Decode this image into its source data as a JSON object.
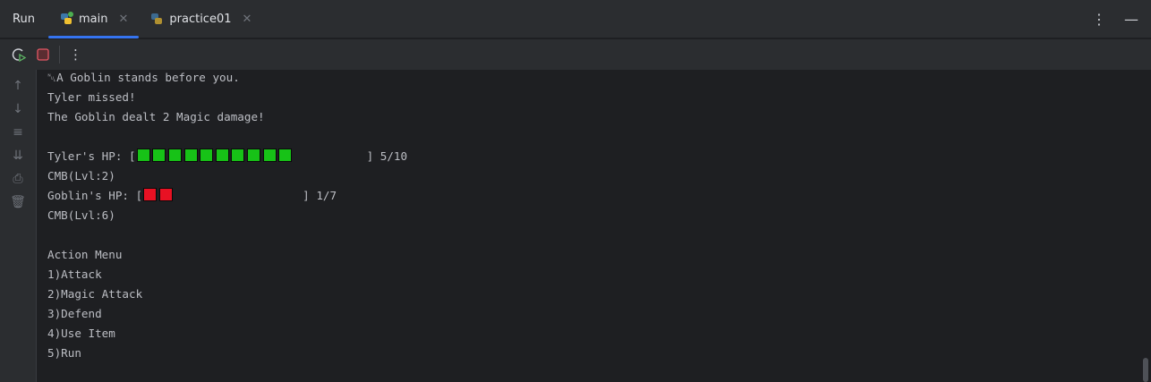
{
  "header": {
    "run_label": "Run",
    "tabs": [
      {
        "label": "main",
        "active": true
      },
      {
        "label": "practice01",
        "active": false
      }
    ]
  },
  "toolbar": {
    "icons": [
      "rerun-icon",
      "stop-icon",
      "more-icon"
    ]
  },
  "console": {
    "intro": "␀A Goblin stands before you.",
    "lines1": [
      "Tyler missed!",
      "The Goblin dealt 2 Magic damage!"
    ],
    "player": {
      "label": "Tyler's HP: [",
      "filled": 10,
      "total": 10,
      "color": "#17c217",
      "suffix": "] 5/10",
      "cmb": "CMB(Lvl:2)"
    },
    "enemy": {
      "label": "Goblin's HP: [",
      "filled": 2,
      "total": 2,
      "color": "#e81123",
      "suffix": "] 1/7",
      "cmb": "CMB(Lvl:6)"
    },
    "menu_title": "Action Menu",
    "menu": [
      "1)Attack",
      "2)Magic Attack",
      "3)Defend",
      "4)Use Item",
      "5)Run"
    ]
  }
}
